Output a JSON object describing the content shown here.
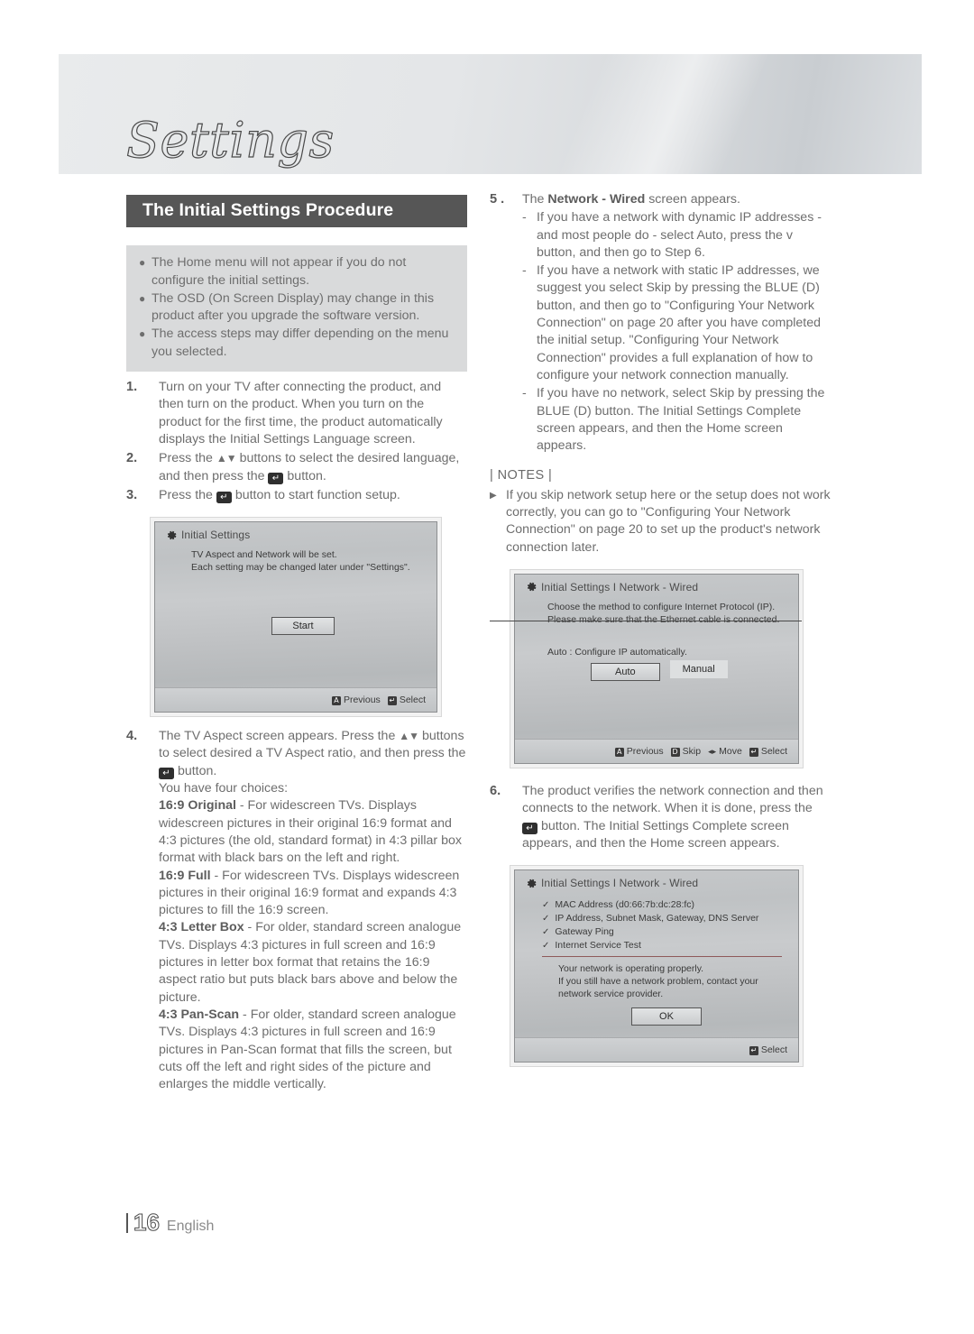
{
  "page": {
    "chapter_title": "Settings",
    "section_title": "The Initial Settings Procedure",
    "footer_page_number": "16",
    "footer_language": "English"
  },
  "intro_notes": [
    "The Home menu will not appear if you do not configure the initial settings.",
    "The OSD (On Screen Display) may change in this product after you upgrade the software version.",
    "The access steps may differ depending on the menu you selected."
  ],
  "steps": {
    "s1_num": "1.",
    "s1_text": "Turn on your TV after connecting the product, and then turn on the product. When you turn on the product for the first time, the product automatically displays the Initial Settings Language screen.",
    "s2_num": "2.",
    "s2_a": "Press the ",
    "s2_arrows": "▲▼",
    "s2_b": " buttons to select the desired language, and then press the ",
    "s2_c": " button.",
    "s3_num": "3.",
    "s3_a": "Press the ",
    "s3_b": " button to start function setup.",
    "s4_num": "4.",
    "s4_a": "The TV Aspect screen appears. Press the ",
    "s4_arrows": "▲▼",
    "s4_b": " buttons to select desired a TV Aspect ratio, and then press the ",
    "s4_c": " button.",
    "s4_d": "You have four choices:",
    "s5_num": "5 .",
    "s5_a": "The ",
    "s5_bold": "Network - Wired",
    "s5_b": " screen appears.",
    "s6_num": "6.",
    "s6_a": "The product verifies the network connection and then connects to the network. When it is done, press the ",
    "s6_b": " button. The Initial Settings Complete screen appears, and then the Home screen appears."
  },
  "aspect_choices": [
    {
      "name": "16:9 Original",
      "desc": " - For widescreen TVs. Displays widescreen pictures in their original 16:9 format and 4:3 pictures (the old, standard format) in 4:3 pillar box format with black bars on the left and right."
    },
    {
      "name": "16:9 Full",
      "desc": " - For widescreen TVs. Displays widescreen pictures in their original 16:9 format and expands 4:3 pictures to fill the 16:9 screen."
    },
    {
      "name": "4:3 Letter Box",
      "desc": " - For older, standard screen analogue TVs. Displays 4:3 pictures in full screen and 16:9 pictures in letter box format that retains the 16:9 aspect ratio but puts black bars above and below the picture."
    },
    {
      "name": "4:3 Pan-Scan",
      "desc": " - For older, standard screen analogue TVs. Displays 4:3 pictures in full screen and 16:9 pictures in Pan-Scan format that fills the screen, but cuts off the left and right sides of the picture and enlarges the middle vertically."
    }
  ],
  "step5_sub": [
    "If you have a network with dynamic IP addresses - and most people do - select Auto, press the v button, and then go to Step 6.",
    "If you have a network with static IP addresses, we suggest you select Skip by pressing the BLUE (D) button, and then go to \"Configuring Your Network Connection\" on page 20 after you have completed the initial setup. \"Configuring Your Network Connection\" provides a full explanation of how to configure your network connection manually.",
    "If you have no network, select Skip by pressing the BLUE (D) button. The Initial Settings Complete screen appears, and then the Home screen appears."
  ],
  "notes": {
    "title": "| NOTES |",
    "items": [
      "If you skip network setup here or the setup does not work correctly, you can go to \"Configuring Your Network Connection\" on page 20 to set up the product's network connection later."
    ]
  },
  "screenshot_initial_settings": {
    "title": "Initial Settings",
    "line1": "TV Aspect and Network will be set.",
    "line2": "Each setting may be changed later under \"Settings\".",
    "start_button": "Start",
    "footer": [
      {
        "key": "A",
        "label": "Previous"
      },
      {
        "key": "↵",
        "label": "Select"
      }
    ]
  },
  "screenshot_network_wired": {
    "title": "Initial Settings I Network - Wired",
    "line1": "Choose the method to configure Internet Protocol (IP).",
    "line2": "Please make sure that the Ethernet cable is connected.",
    "line3": "Auto : Configure IP automatically.",
    "auto_button": "Auto",
    "manual_button": "Manual",
    "footer": [
      {
        "key": "A",
        "label": "Previous"
      },
      {
        "key": "D",
        "label": "Skip"
      },
      {
        "key": "◂▸",
        "label": "Move"
      },
      {
        "key": "↵",
        "label": "Select"
      }
    ]
  },
  "screenshot_network_test": {
    "title": "Initial Settings I Network - Wired",
    "checks": [
      "MAC Address (d0:66:7b:dc:28:fc)",
      "IP Address, Subnet Mask, Gateway, DNS Server",
      "Gateway Ping",
      "Internet Service Test"
    ],
    "message1": "Your network is operating properly.",
    "message2": "If you still have a network problem, contact your network service provider.",
    "ok_button": "OK",
    "footer": [
      {
        "key": "↵",
        "label": "Select"
      }
    ]
  },
  "colors": {
    "section_header_bg": "#565656",
    "note_box_bg": "#d9dadb",
    "body_text": "#6e6e6e",
    "divider_red": "#8f5a5a"
  }
}
